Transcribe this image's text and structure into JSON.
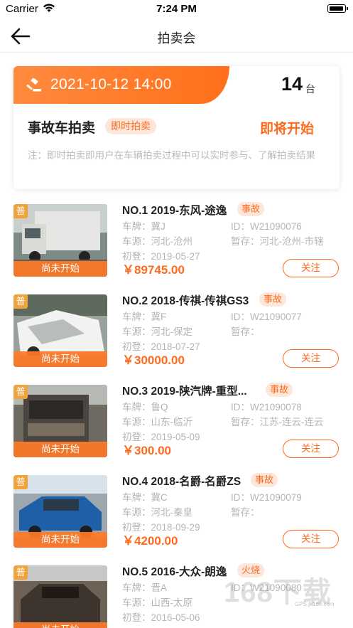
{
  "status_bar": {
    "carrier": "Carrier",
    "time": "7:24 PM"
  },
  "nav": {
    "title": "拍卖会",
    "back_icon": "arrow-left-icon"
  },
  "session": {
    "datetime": "2021-10-12  14:00",
    "vehicle_count": "14",
    "count_unit": "台",
    "name": "事故车拍卖",
    "type_label": "即时拍卖",
    "status": "即将开始",
    "note": "注：即时拍卖即用户在车辆拍卖过程中可以实时参与、了解拍卖结果",
    "banner_color": "#ff7a28",
    "accent_color": "#ff6a1f"
  },
  "lots": [
    {
      "grade": "普",
      "sale_state": "尚未开始",
      "title": "NO.1 2019-东风-途逸",
      "tag": "事故",
      "plate": "车牌：冀J",
      "id": "ID：W21090076",
      "origin": "车源：河北-沧州",
      "storage": "暂存：河北-沧州-市辖",
      "first_reg": "初登：2019-05-27",
      "price": "￥89745.00",
      "follow": "关注"
    },
    {
      "grade": "普",
      "sale_state": "尚未开始",
      "title": "NO.2 2018-传祺-传祺GS3",
      "tag": "事故",
      "plate": "车牌：冀F",
      "id": "ID：W21090077",
      "origin": "车源：河北-保定",
      "storage": "暂存：",
      "first_reg": "初登：2018-07-27",
      "price": "￥30000.00",
      "follow": "关注"
    },
    {
      "grade": "普",
      "sale_state": "尚未开始",
      "title": "NO.3 2019-陕汽牌-重型...",
      "tag": "事故",
      "plate": "车牌：鲁Q",
      "id": "ID：W21090078",
      "origin": "车源：山东-临沂",
      "storage": "暂存：江苏-连云-连云",
      "first_reg": "初登：2019-05-09",
      "price": "￥300.00",
      "follow": "关注"
    },
    {
      "grade": "普",
      "sale_state": "尚未开始",
      "title": "NO.4 2018-名爵-名爵ZS",
      "tag": "事故",
      "plate": "车牌：冀C",
      "id": "ID：W21090079",
      "origin": "车源：河北-秦皇",
      "storage": "暂存：",
      "first_reg": "初登：2018-09-29",
      "price": "￥4200.00",
      "follow": "关注"
    },
    {
      "grade": "普",
      "sale_state": "尚未开始",
      "title": "NO.5 2016-大众-朗逸",
      "tag": "火烧",
      "plate": "车牌：晋A",
      "id": "ID：W21090080",
      "origin": "车源：山西-太原",
      "storage": "",
      "first_reg": "初登：2016-05-06",
      "price": "",
      "follow": ""
    }
  ],
  "watermark": {
    "text": "168下载",
    "url": "GPS.jk168.com"
  }
}
